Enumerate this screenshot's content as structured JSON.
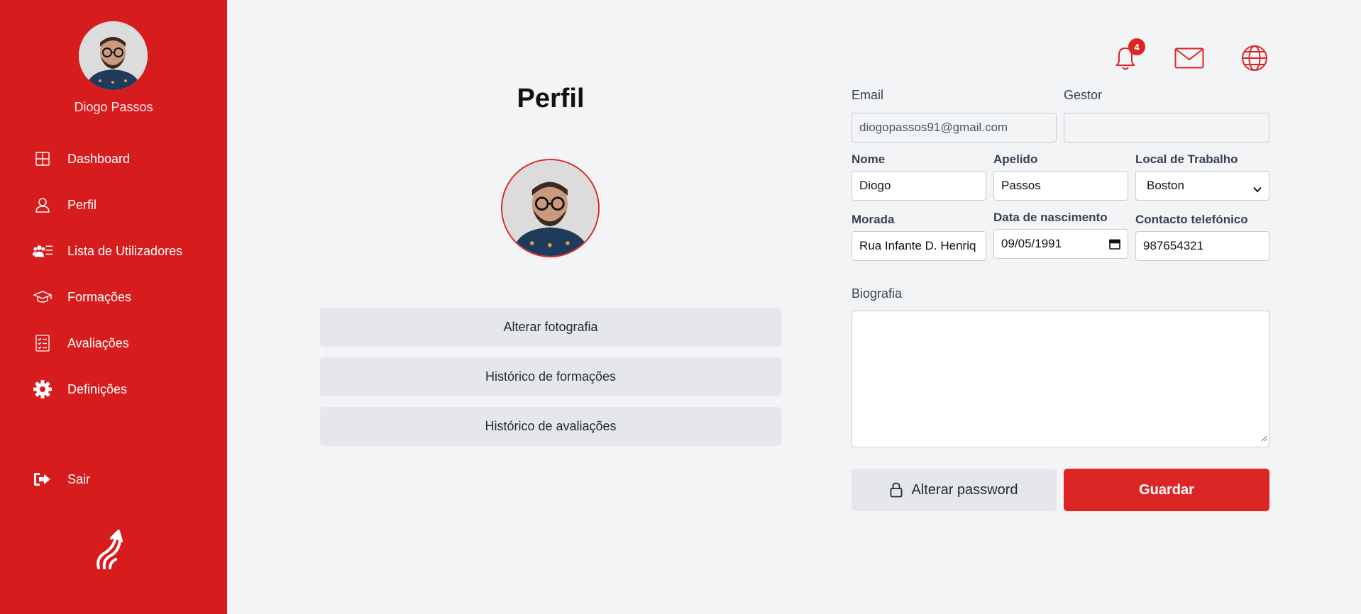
{
  "user": {
    "name": "Diogo Passos"
  },
  "sidebar": {
    "items": [
      {
        "label": "Dashboard",
        "icon": "grid-icon"
      },
      {
        "label": "Perfil",
        "icon": "user-icon"
      },
      {
        "label": "Lista de Utilizadores",
        "icon": "users-list-icon"
      },
      {
        "label": "Formações",
        "icon": "graduation-cap-icon"
      },
      {
        "label": "Avaliações",
        "icon": "checklist-icon"
      },
      {
        "label": "Definições",
        "icon": "gear-icon"
      }
    ],
    "logout": {
      "label": "Sair",
      "icon": "sign-out-icon"
    }
  },
  "topbar": {
    "notification_count": "4"
  },
  "profile": {
    "title": "Perfil",
    "buttons": {
      "change_photo": "Alterar fotografia",
      "training_history": "Histórico de formações",
      "evaluation_history": "Histórico de avaliações"
    }
  },
  "form": {
    "email": {
      "label": "Email",
      "value": "diogopassos91@gmail.com"
    },
    "manager": {
      "label": "Gestor",
      "value": ""
    },
    "first_name": {
      "label": "Nome",
      "value": "Diogo"
    },
    "last_name": {
      "label": "Apelido",
      "value": "Passos"
    },
    "workplace": {
      "label": "Local de Trabalho",
      "value": "Boston"
    },
    "address": {
      "label": "Morada",
      "value": "Rua Infante D. Henriq"
    },
    "birthdate": {
      "label": "Data de nascimento",
      "value": "09/05/1991"
    },
    "phone": {
      "label": "Contacto telefónico",
      "value": "987654321"
    },
    "bio": {
      "label": "Biografia",
      "value": ""
    },
    "change_password": "Alterar password",
    "save": "Guardar"
  },
  "colors": {
    "brand_red": "#d71c1e",
    "button_red": "#dc2626",
    "background": "#f3f4f6"
  }
}
